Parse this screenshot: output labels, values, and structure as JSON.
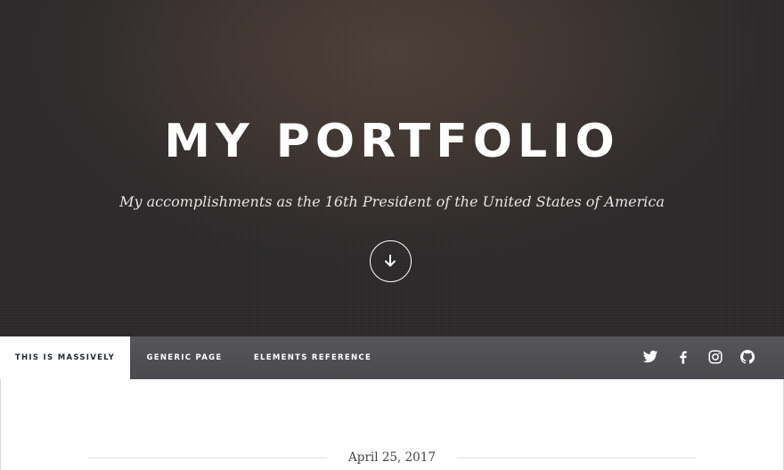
{
  "hero": {
    "title": "MY PORTFOLIO",
    "subtitle": "My accomplishments as the 16th President of the United States of America",
    "scroll_icon": "arrow-down-icon"
  },
  "nav": {
    "tabs": [
      {
        "label": "THIS IS MASSIVELY",
        "active": true
      },
      {
        "label": "GENERIC PAGE",
        "active": false
      },
      {
        "label": "ELEMENTS REFERENCE",
        "active": false
      }
    ],
    "social_icons": [
      "twitter-icon",
      "facebook-icon",
      "instagram-icon",
      "github-icon"
    ]
  },
  "post": {
    "date": "April 25, 2017"
  },
  "colors": {
    "nav_background": "#4f4e53",
    "active_tab_text": "#212931",
    "hero_text": "#ffffff"
  }
}
